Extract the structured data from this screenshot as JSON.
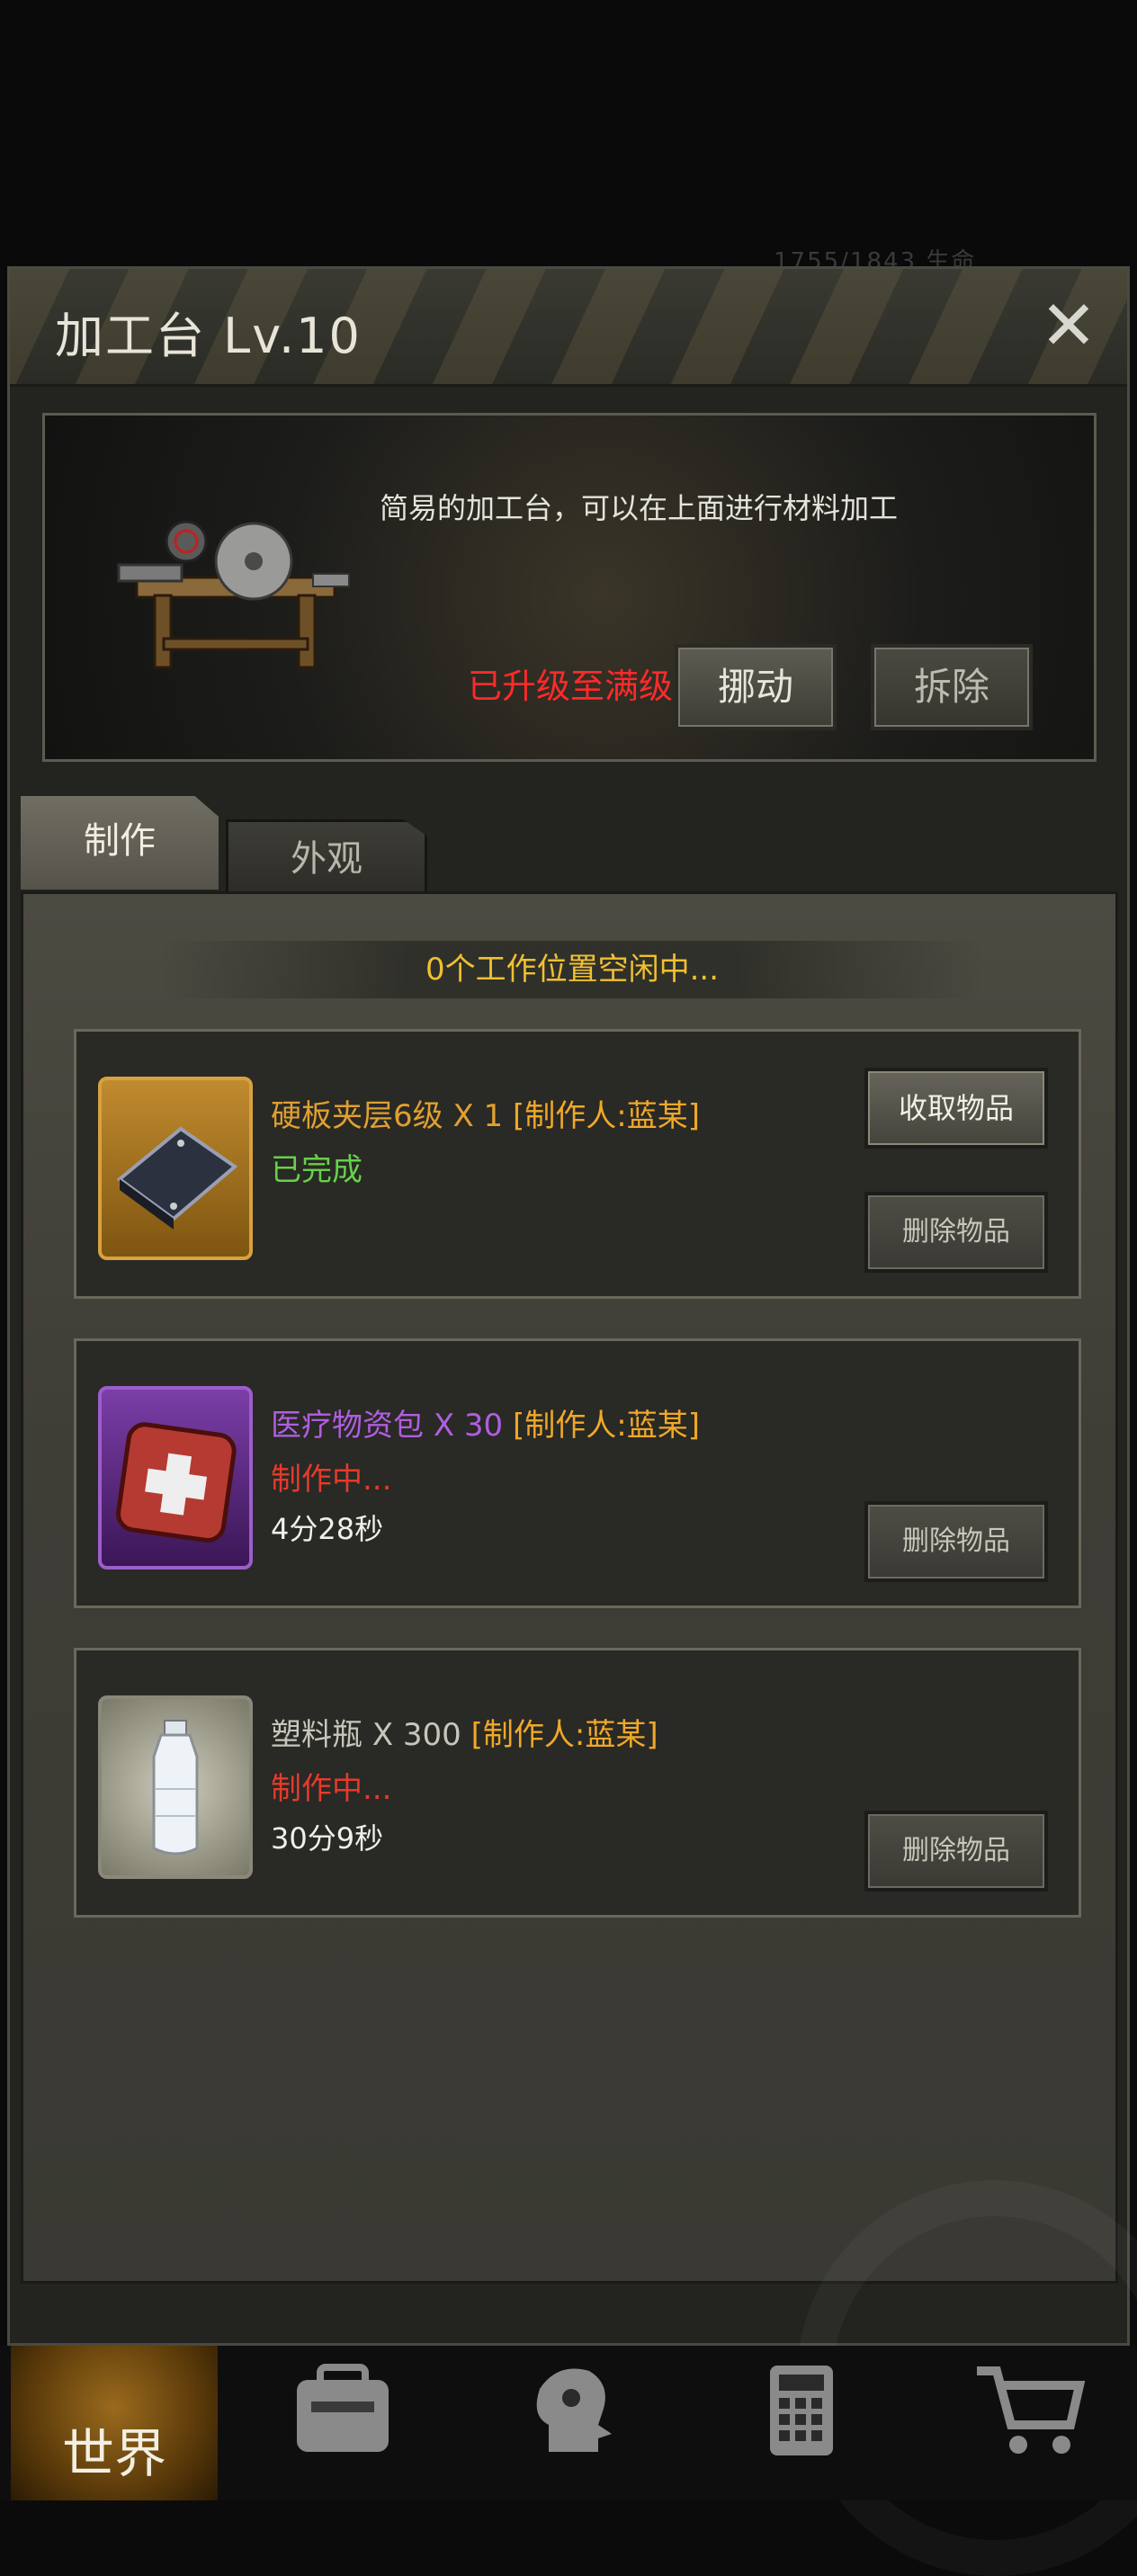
{
  "hud": {
    "faded_text": "1755/1843    生命"
  },
  "dialog": {
    "title": "加工台 Lv.10",
    "close_glyph": "✕",
    "info": {
      "description": "简易的加工台，可以在上面进行材料加工",
      "max_level_text": "已升级至满级",
      "move_label": "挪动",
      "dismantle_label": "拆除"
    },
    "tabs": [
      {
        "label": "制作",
        "active": true
      },
      {
        "label": "外观",
        "active": false
      }
    ],
    "slots_text": "0个工作位置空闲中...",
    "items": [
      {
        "name": "硬板夹层6级",
        "qty": "X 1",
        "maker": "[制作人:蓝某]",
        "name_color": "#e0a030",
        "status": "已完成",
        "status_color": "#66d14a",
        "time": "",
        "collect_label": "收取物品",
        "delete_label": "删除物品",
        "icon": "armor-plate-icon"
      },
      {
        "name": "医疗物资包",
        "qty": "X 30",
        "maker": "[制作人:蓝某]",
        "name_color": "#b05ee0",
        "status": "制作中...",
        "status_color": "#e63a2a",
        "time": "4分28秒",
        "delete_label": "删除物品",
        "icon": "medkit-icon"
      },
      {
        "name": "塑料瓶",
        "qty": "X 300",
        "maker": "[制作人:蓝某]",
        "name_color": "#c8c6bc",
        "status": "制作中...",
        "status_color": "#e63a2a",
        "time": "30分9秒",
        "delete_label": "删除物品",
        "icon": "plastic-bottle-icon"
      }
    ],
    "maker_color": "#f0a828"
  },
  "bottom_nav": {
    "world_label": "世界",
    "items": [
      "backpack-icon",
      "character-icon",
      "calculator-icon",
      "shop-cart-icon"
    ]
  }
}
